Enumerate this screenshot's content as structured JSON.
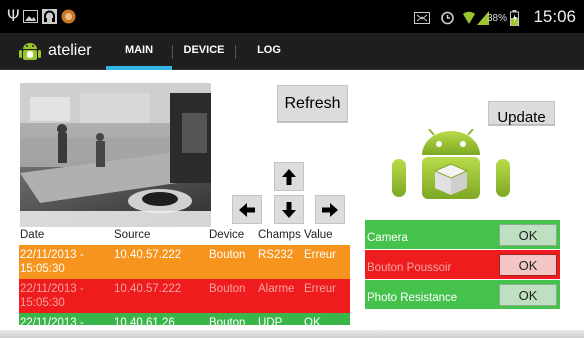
{
  "status_bar": {
    "left_icons": [
      "usb-icon",
      "image-icon",
      "headset-icon",
      "app-icon"
    ],
    "right_icons": [
      "bluetooth-icon",
      "alarm-icon",
      "wifi-icon",
      "signal-icon",
      "battery-icon"
    ],
    "battery": "38%",
    "time": "15:06"
  },
  "action_bar": {
    "app_icon": "android-icon",
    "title": "atelier",
    "tabs": [
      {
        "label": "MAIN",
        "selected": true
      },
      {
        "label": "DEVICE",
        "selected": false
      },
      {
        "label": "LOG",
        "selected": false
      }
    ],
    "accent": "#33b5e5"
  },
  "main": {
    "refresh_label": "Refresh",
    "update_label": "Update",
    "arrows": [
      "arrow-up-icon",
      "arrow-left-icon",
      "arrow-down-icon",
      "arrow-right-icon"
    ],
    "log_table": {
      "headers": [
        "Date",
        "Source",
        "Device",
        "Champs",
        "Value"
      ],
      "rows": [
        {
          "date": "22/11/2013 - 15:05:30",
          "date_l1": "22/11/2013 -",
          "date_l2": "15:05:30",
          "source": "10.40.57.222",
          "device": "Bouton",
          "champs": "RS232",
          "value": "Erreur",
          "color": "#f7941d"
        },
        {
          "date": "22/11/2013 - 15:05:30",
          "date_l1": "22/11/2013 -",
          "date_l2": "15:05:30",
          "source": "10.40.57.222",
          "device": "Bouton",
          "champs": "Alarme",
          "value": "Erreur",
          "color": "#ee1c1c"
        },
        {
          "date": "22/11/2013 -",
          "date_l1": "22/11/2013 -",
          "date_l2": "",
          "source": "10.40.61.26",
          "device": "Bouton",
          "champs": "UDP",
          "value": "OK",
          "color": "#39b54a"
        }
      ]
    },
    "status_panel": [
      {
        "label": "Camera",
        "button": "OK",
        "color": "#44c24c"
      },
      {
        "label": "Bouton Poussoir",
        "button": "OK",
        "color": "#ee1c1c"
      },
      {
        "label": "Photo Resistance",
        "button": "OK",
        "color": "#44c24c"
      }
    ]
  }
}
